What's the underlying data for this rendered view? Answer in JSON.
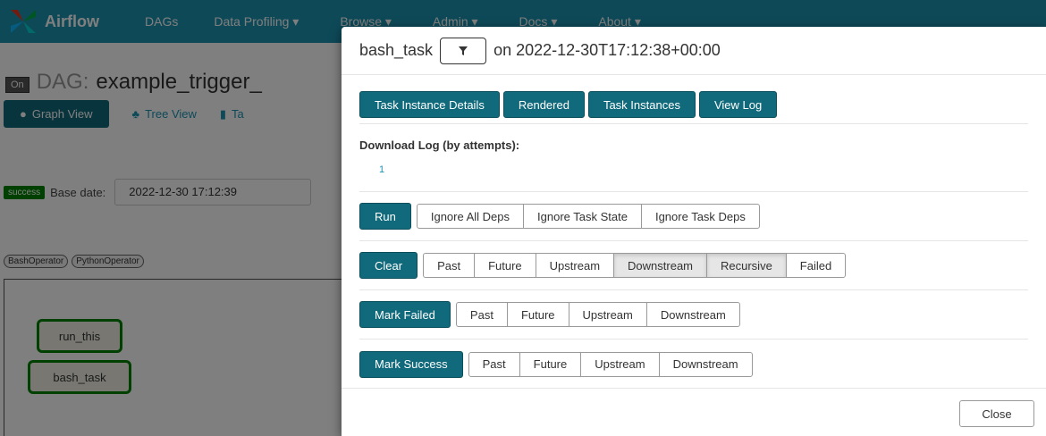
{
  "navbar": {
    "brand": "Airflow",
    "items": [
      "DAGs",
      "Data Profiling",
      "Browse",
      "Admin",
      "Docs",
      "About"
    ]
  },
  "dag": {
    "toggle": "On",
    "prefix": "DAG:",
    "name": "example_trigger_"
  },
  "view_tabs": {
    "graph": "Graph View",
    "tree": "Tree View",
    "other": "Ta"
  },
  "status": {
    "badge": "success",
    "base_label": "Base date:",
    "base_date": "2022-12-30 17:12:39"
  },
  "operators": [
    "BashOperator",
    "PythonOperator"
  ],
  "graph_nodes": [
    "run_this",
    "bash_task"
  ],
  "modal": {
    "task": "bash_task",
    "date_text": "on 2022-12-30T17:12:38+00:00",
    "actions": [
      "Task Instance Details",
      "Rendered",
      "Task Instances",
      "View Log"
    ],
    "download_label": "Download Log (by attempts):",
    "attempt": "1",
    "run": {
      "label": "Run",
      "options": [
        "Ignore All Deps",
        "Ignore Task State",
        "Ignore Task Deps"
      ]
    },
    "clear": {
      "label": "Clear",
      "options": [
        "Past",
        "Future",
        "Upstream",
        "Downstream",
        "Recursive",
        "Failed"
      ]
    },
    "mark_failed": {
      "label": "Mark Failed",
      "options": [
        "Past",
        "Future",
        "Upstream",
        "Downstream"
      ]
    },
    "mark_success": {
      "label": "Mark Success",
      "options": [
        "Past",
        "Future",
        "Upstream",
        "Downstream"
      ]
    },
    "close": "Close"
  },
  "colors": {
    "navbar": "#1c93b0",
    "primary": "#116a7b",
    "success": "#008000"
  }
}
